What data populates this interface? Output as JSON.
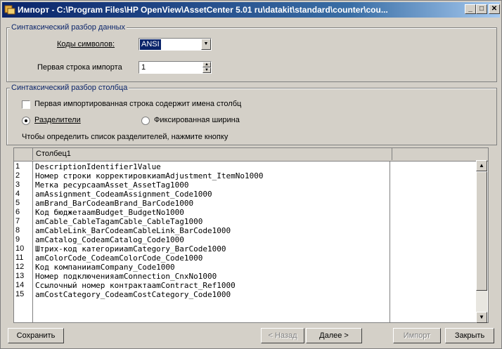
{
  "window": {
    "title": "Импорт - C:\\Program Files\\HP OpenView\\AssetCenter 5.01 ru\\datakit\\standard\\counter\\cou...",
    "minimize_glyph": "_",
    "maximize_glyph": "□",
    "close_glyph": "✕"
  },
  "data_parsing": {
    "group_label": "Синтаксический разбор данных",
    "encoding_label": "Коды символов:",
    "encoding_value": "ANSI",
    "first_row_label": "Первая строка импорта",
    "first_row_value": "1"
  },
  "column_parsing": {
    "group_label": "Синтаксический разбор столбца",
    "header_checkbox_label": "Первая импортированная строка содержит имена столбц",
    "header_checkbox_checked": false,
    "radio_separators_label": "Разделители",
    "radio_fixed_label": "Фиксированная ширина",
    "selected_mode": "separators",
    "hint": "Чтобы определить список разделителей, нажмите кнопку"
  },
  "grid": {
    "column_header": "Столбец1",
    "rows": [
      {
        "num": "1",
        "text": "DescriptionIdentifier1Value"
      },
      {
        "num": "2",
        "text": "Номер строки корректировкиamAdjustment_ItemNo1000"
      },
      {
        "num": "3",
        "text": "Метка ресурсаamAsset_AssetTag1000"
      },
      {
        "num": "4",
        "text": "amAssignment_CodeamAssignment_Code1000"
      },
      {
        "num": "5",
        "text": "amBrand_BarCodeamBrand_BarCode1000"
      },
      {
        "num": "6",
        "text": "Код бюджетаamBudget_BudgetNo1000"
      },
      {
        "num": "7",
        "text": "amCable_CableTagamCable_CableTag1000"
      },
      {
        "num": "8",
        "text": "amCableLink_BarCodeamCableLink_BarCode1000"
      },
      {
        "num": "9",
        "text": "amCatalog_CodeamCatalog_Code1000"
      },
      {
        "num": "10",
        "text": "Штрих-код категорииamCategory_BarCode1000"
      },
      {
        "num": "11",
        "text": "amColorCode_CodeamColorCode_Code1000"
      },
      {
        "num": "12",
        "text": "Код компанииamCompany_Code1000"
      },
      {
        "num": "13",
        "text": "Номер подключенияamConnection_CnxNo1000"
      },
      {
        "num": "14",
        "text": "Ссылочный номер контрактаamContract_Ref1000"
      },
      {
        "num": "15",
        "text": "amCostCategory_CodeamCostCategory_Code1000"
      }
    ]
  },
  "buttons": {
    "save": "Сохранить",
    "back": "< Назад",
    "next": "Далее >",
    "import": "Импорт",
    "close": "Закрыть"
  },
  "colors": {
    "titlebar_start": "#0a246a",
    "titlebar_end": "#a6caf0",
    "window_face": "#d4d0c8",
    "group_label": "#0a246a"
  }
}
